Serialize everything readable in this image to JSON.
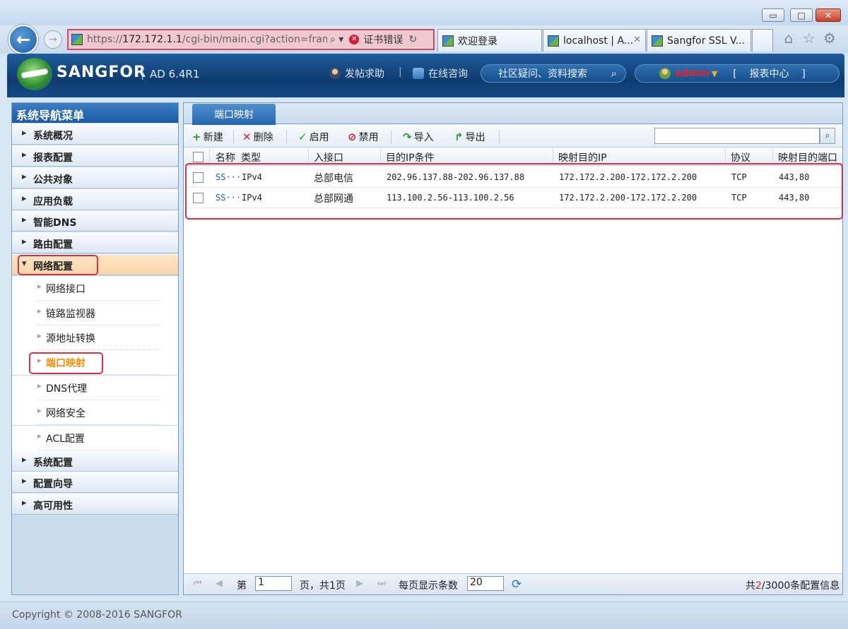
{
  "browser": {
    "url_prefix": "https://",
    "url_host": "172.172.1.1",
    "url_rest": "/cgi-bin/main.cgi?action=frame",
    "search_hint": "⌕ ▾",
    "cert_error": "证书错误",
    "tabs": [
      {
        "label": "欢迎登录"
      },
      {
        "label": "localhost | A..."
      },
      {
        "label": "Sangfor SSL V..."
      }
    ]
  },
  "header": {
    "brand": "SANGFOR",
    "separator": "|",
    "version": "AD 6.4R1",
    "help_link": "发帖求助",
    "divider": "|",
    "consult_link": "在线咨询",
    "search_text": "社区疑问、资料搜索",
    "user": "admin",
    "report_center": "[    报表中心    ]"
  },
  "sidebar": {
    "title": "系统导航菜单",
    "items_top": [
      "系统概况",
      "报表配置",
      "公共对象",
      "应用负载",
      "智能DNS",
      "路由配置"
    ],
    "network": "网络配置",
    "sub_items": [
      "网络接口",
      "链路监视器",
      "源地址转换",
      "端口映射",
      "DNS代理",
      "网络安全",
      "ACL配置"
    ],
    "items_bottom": [
      "系统配置",
      "配置向导",
      "高可用性"
    ]
  },
  "main": {
    "tab": "端口映射",
    "toolbar": {
      "new": "新建",
      "delete": "删除",
      "enable": "启用",
      "disable": "禁用",
      "import": "导入",
      "export": "导出"
    },
    "columns": [
      "名称",
      "类型",
      "入接口",
      "目的IP条件",
      "映射目的IP",
      "协议",
      "映射目的端口"
    ],
    "rows": [
      {
        "name": "SS···",
        "type": "IPv4",
        "iface": "总部电信",
        "dst": "202.96.137.88-202.96.137.88",
        "map_ip": "172.172.2.200-172.172.2.200",
        "proto": "TCP",
        "port": "443,80"
      },
      {
        "name": "SS···",
        "type": "IPv4",
        "iface": "总部网通",
        "dst": "113.100.2.56-113.100.2.56",
        "map_ip": "172.172.2.200-172.172.2.200",
        "proto": "TCP",
        "port": "443,80"
      }
    ]
  },
  "pager": {
    "page_prefix": "第",
    "page_value": "1",
    "page_suffix": "页，共1页",
    "per_page_label": "每页显示条数",
    "per_page_value": "20",
    "total_prefix": "共",
    "total_current": "2",
    "total_suffix": "/3000条配置信息"
  },
  "footer": {
    "copyright": "Copyright © 2008-2016 SANGFOR"
  },
  "colors": {
    "accent": "#1c5aa2",
    "highlight": "#d9314a",
    "active_sub": "#f09010",
    "admin": "#e8212a"
  }
}
